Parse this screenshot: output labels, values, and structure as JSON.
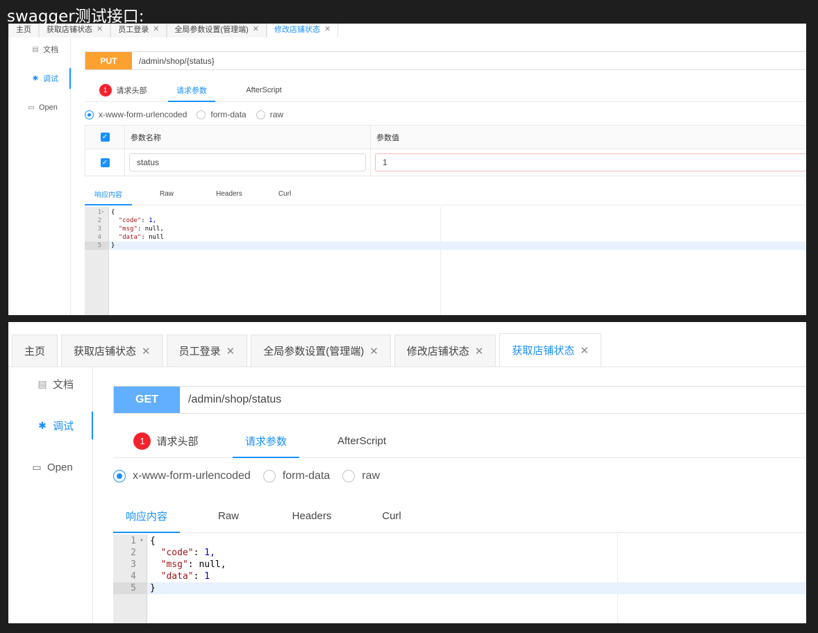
{
  "page_heading": "swagger测试接口:",
  "colors": {
    "accent": "#1890ff",
    "put_method": "#fca130",
    "get_method": "#61affe",
    "badge": "#f5222d"
  },
  "top": {
    "tabs": [
      {
        "label": "主页",
        "closable": false
      },
      {
        "label": "获取店铺状态",
        "closable": true
      },
      {
        "label": "员工登录",
        "closable": true
      },
      {
        "label": "全局参数设置(管理端)",
        "closable": true
      },
      {
        "label": "修改店铺状态",
        "closable": true,
        "active": true
      }
    ],
    "sidebar": [
      {
        "icon": "document-icon",
        "label": "文档"
      },
      {
        "icon": "bug-icon",
        "label": "调试",
        "active": true
      },
      {
        "icon": "file-icon",
        "label": "Open"
      }
    ],
    "method": "PUT",
    "url": "/admin/shop/{status}",
    "request_tabs": {
      "badge": "1",
      "headers": "请求头部",
      "params": "请求参数",
      "afterscript": "AfterScript"
    },
    "radios": [
      "x-www-form-urlencoded",
      "form-data",
      "raw"
    ],
    "params_table": {
      "col_name": "参数名称",
      "col_value": "参数值",
      "rows": [
        {
          "name": "status",
          "value": "1"
        }
      ]
    },
    "response_tabs": [
      "响应内容",
      "Raw",
      "Headers",
      "Curl"
    ],
    "code": [
      {
        "n": "1",
        "t": "{"
      },
      {
        "n": "2",
        "k": "\"code\"",
        "v": " 1,",
        "i": "  "
      },
      {
        "n": "3",
        "k": "\"msg\"",
        "v": " null,",
        "i": "  "
      },
      {
        "n": "4",
        "k": "\"data\"",
        "v": " null",
        "i": "  "
      },
      {
        "n": "5",
        "t": "}"
      }
    ]
  },
  "bottom": {
    "tabs": [
      {
        "label": "主页",
        "closable": false
      },
      {
        "label": "获取店铺状态",
        "closable": true
      },
      {
        "label": "员工登录",
        "closable": true
      },
      {
        "label": "全局参数设置(管理端)",
        "closable": true
      },
      {
        "label": "修改店铺状态",
        "closable": true
      },
      {
        "label": "获取店铺状态",
        "closable": true,
        "active": true
      }
    ],
    "sidebar": [
      {
        "icon": "document-icon",
        "label": "文档"
      },
      {
        "icon": "bug-icon",
        "label": "调试",
        "active": true
      },
      {
        "icon": "file-icon",
        "label": "Open"
      }
    ],
    "method": "GET",
    "url": "/admin/shop/status",
    "request_tabs": {
      "badge": "1",
      "headers": "请求头部",
      "params": "请求参数",
      "afterscript": "AfterScript"
    },
    "radios": [
      "x-www-form-urlencoded",
      "form-data",
      "raw"
    ],
    "response_tabs": [
      "响应内容",
      "Raw",
      "Headers",
      "Curl"
    ],
    "code": [
      {
        "n": "1",
        "t": "{"
      },
      {
        "n": "2",
        "k": "\"code\"",
        "v": " 1,",
        "i": "  "
      },
      {
        "n": "3",
        "k": "\"msg\"",
        "v": " null,",
        "i": "  "
      },
      {
        "n": "4",
        "k": "\"data\"",
        "v": " 1",
        "i": "  "
      },
      {
        "n": "5",
        "t": "}"
      }
    ]
  }
}
